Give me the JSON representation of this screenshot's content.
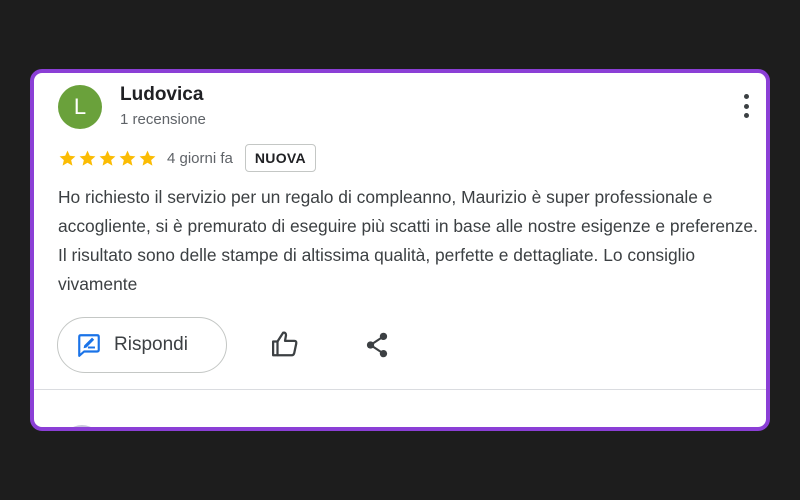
{
  "review": {
    "avatar_letter": "L",
    "reviewer_name": "Ludovica",
    "review_count": "1 recensione",
    "rating": 5,
    "rating_max": 5,
    "date": "4 giorni fa",
    "badge": "NUOVA",
    "text": "Ho richiesto il servizio per un regalo di compleanno, Maurizio è super professionale e accogliente, si è premurato di eseguire più scatti in base alle nostre esigenze e preferenze. Il risultato sono delle stampe di altissima qualità, perfette e dettagliate. Lo consiglio vivamente"
  },
  "actions": {
    "reply_label": "Rispondi",
    "reply_icon": "reply-icon",
    "like_icon": "thumb-up-icon",
    "share_icon": "share-icon",
    "more_icon": "more-vert-icon"
  },
  "colors": {
    "frame": "#8b3fd6",
    "avatar_bg": "#6aa13b",
    "star": "#fbbc04",
    "reply_icon": "#1a73e8",
    "background": "#1d1d1d"
  }
}
